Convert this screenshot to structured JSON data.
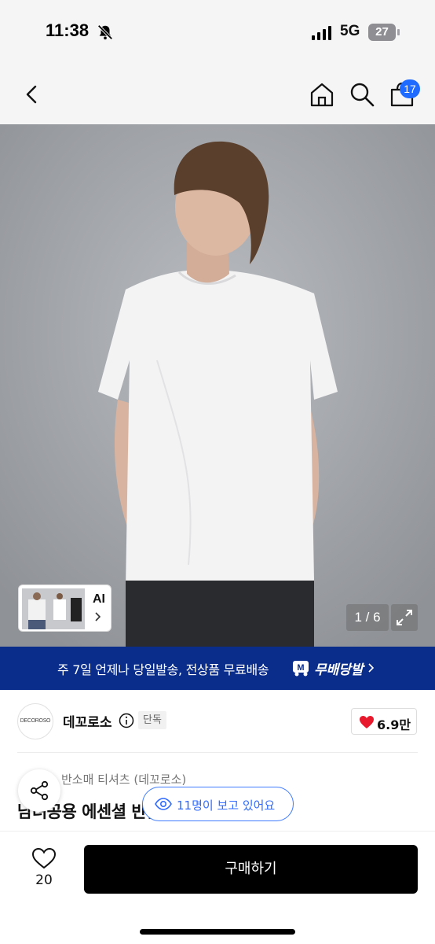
{
  "status_bar": {
    "time": "11:38",
    "network": "5G",
    "battery": "27"
  },
  "nav": {
    "cart_count": "17"
  },
  "gallery": {
    "ai_label": "AI",
    "page_counter": "1 / 6"
  },
  "shipping_banner": {
    "text": "주 7일 언제나 당일발송, 전상품 무료배송",
    "service_name": "무배당발"
  },
  "brand": {
    "logo_text": "DECOROSO",
    "name": "데꼬로소",
    "badge": "단독",
    "likes": "6.9만"
  },
  "product": {
    "breadcrumb": "반소매 티셔츠 (데꼬로소)",
    "title": "남녀공용 에센셜 반팔 티셔츠 ["
  },
  "viewers": {
    "text": "11명이 보고 있어요"
  },
  "bottom_bar": {
    "wish_count": "20",
    "buy_label": "구매하기"
  },
  "colors": {
    "banner_bg": "#0a2c8a",
    "accent_blue": "#1f6bff",
    "heart_red": "#e8192c",
    "buy_button_bg": "#000000"
  }
}
